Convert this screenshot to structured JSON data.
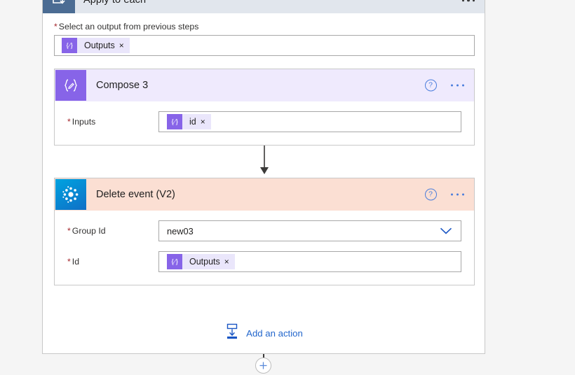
{
  "scope": {
    "title": "Apply to each",
    "icon": "foreach-loop-icon",
    "menu_icon": "ellipsis-icon",
    "input_label": "Select an output from previous steps",
    "required_mark": "*",
    "input_token": {
      "icon": "expression-icon",
      "icon_glyph": "{⁄}",
      "label": "Outputs",
      "remove": "×"
    }
  },
  "compose_card": {
    "title": "Compose 3",
    "icon": "compose-icon",
    "icon_glyph": "{✎}",
    "help": "?",
    "menu_icon": "ellipsis-icon",
    "fields": [
      {
        "label": "Inputs",
        "required_mark": "*",
        "token": {
          "icon": "expression-icon",
          "icon_glyph": "{⁄}",
          "label": "id",
          "remove": "×"
        }
      }
    ]
  },
  "delete_card": {
    "title": "Delete event (V2)",
    "icon": "office365-groups-icon",
    "help": "?",
    "menu_icon": "ellipsis-icon",
    "group_id": {
      "label": "Group Id",
      "required_mark": "*",
      "value": "new03",
      "chevron_icon": "chevron-down-icon"
    },
    "id_field": {
      "label": "Id",
      "required_mark": "*",
      "token": {
        "icon": "expression-icon",
        "icon_glyph": "{⁄}",
        "label": "Outputs",
        "remove": "×"
      }
    }
  },
  "add_action": {
    "label": "Add an action",
    "icon": "add-action-icon"
  },
  "bottom_plus": {
    "icon": "plus-icon",
    "glyph": "+"
  },
  "colors": {
    "page_background": "#f5f5f5",
    "scope_header": "#e1e6ed",
    "scope_icon": "#4b6c93",
    "compose_purple": "#8764e8",
    "compose_header": "#efeafd",
    "delete_header": "#fbdfd3",
    "link_blue": "#2266cc",
    "required_red": "#a4262c"
  }
}
